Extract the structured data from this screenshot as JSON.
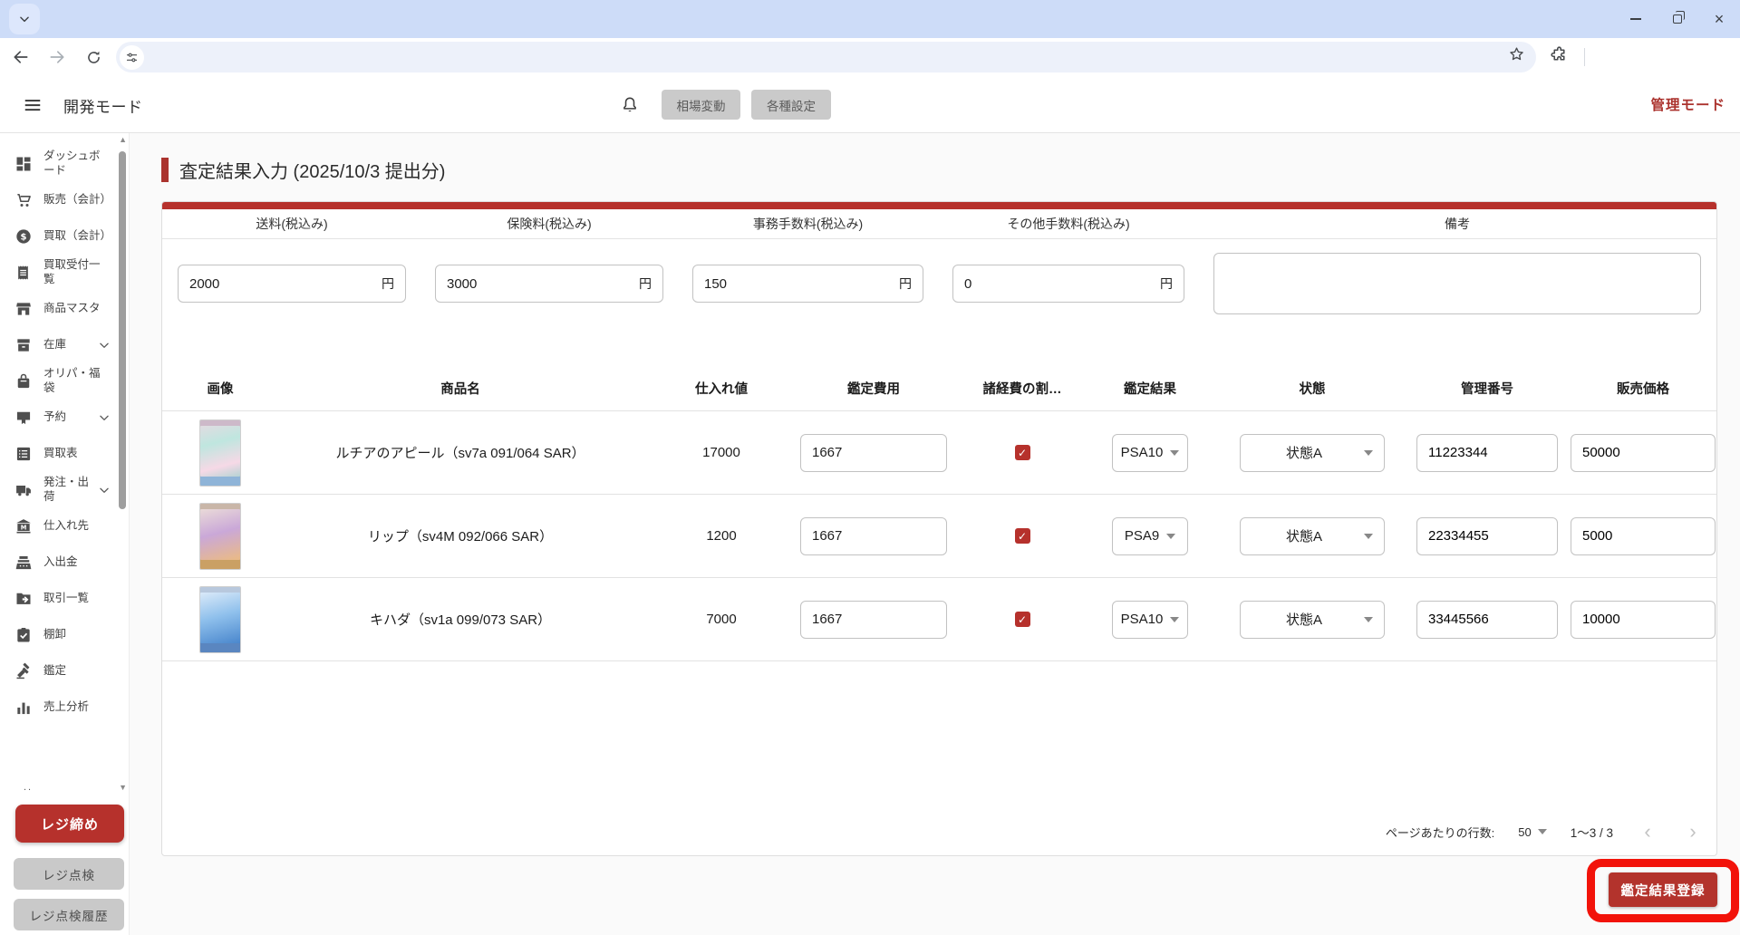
{
  "colors": {
    "accent": "#ab332e",
    "annotation": "#f2130a",
    "tabstrip": "#cddcf8",
    "header_button_bg": "#cacaca"
  },
  "icons": {
    "check": "✓",
    "page_prev": "‹",
    "page_next": "›",
    "scroll_up": "▲",
    "scroll_down": "▼",
    "close_window": "×",
    "more": ".."
  },
  "header": {
    "app_title": "開発モード",
    "market_button": "相場変動",
    "settings_button": "各種設定",
    "admin_link": "管理モード"
  },
  "sidebar": {
    "items": [
      {
        "label": "ダッシュボード",
        "icon": "dashboard-icon"
      },
      {
        "label": "販売（会計）",
        "icon": "cart-icon"
      },
      {
        "label": "買取（会計）",
        "icon": "money-icon"
      },
      {
        "label": "買取受付一覧",
        "icon": "receipt-icon"
      },
      {
        "label": "商品マスタ",
        "icon": "storefront-icon"
      },
      {
        "label": "在庫",
        "icon": "inventory-icon",
        "expandable": true
      },
      {
        "label": "オリパ・福袋",
        "icon": "bag-icon"
      },
      {
        "label": "予約",
        "icon": "reservation-icon",
        "expandable": true
      },
      {
        "label": "買取表",
        "icon": "list-icon"
      },
      {
        "label": "発注・出荷",
        "icon": "truck-icon",
        "expandable": true
      },
      {
        "label": "仕入れ先",
        "icon": "bank-icon"
      },
      {
        "label": "入出金",
        "icon": "register-icon"
      },
      {
        "label": "取引一覧",
        "icon": "folder-icon"
      },
      {
        "label": "棚卸",
        "icon": "clipboard-icon"
      },
      {
        "label": "鑑定",
        "icon": "gavel-icon"
      },
      {
        "label": "売上分析",
        "icon": "chart-icon"
      }
    ],
    "close_register_button": "レジ締め",
    "check_register_button": "レジ点検",
    "check_history_button": "レジ点検履歴"
  },
  "page": {
    "title": "査定結果入力 (2025/10/3 提出分)"
  },
  "fees": {
    "fields": [
      {
        "label": "送料(税込み)",
        "value": "2000",
        "unit": "円"
      },
      {
        "label": "保険料(税込み)",
        "value": "3000",
        "unit": "円"
      },
      {
        "label": "事務手数料(税込み)",
        "value": "150",
        "unit": "円"
      },
      {
        "label": "その他手数料(税込み)",
        "value": "0",
        "unit": "円"
      }
    ],
    "remarks_label": "備考",
    "remarks_value": ""
  },
  "table": {
    "columns": [
      "画像",
      "商品名",
      "仕入れ値",
      "鑑定費用",
      "諸経費の割…",
      "鑑定結果",
      "状態",
      "管理番号",
      "販売価格"
    ],
    "rows": [
      {
        "name": "ルチアのアピール（sv7a 091/064 SAR）",
        "purchase_price": "17000",
        "appraisal_fee": "1667",
        "expense_split_checked": true,
        "appraisal_result": "PSA10",
        "condition": "状態A",
        "management_number": "11223344",
        "selling_price": "50000"
      },
      {
        "name": "リップ（sv4M 092/066 SAR）",
        "purchase_price": "1200",
        "appraisal_fee": "1667",
        "expense_split_checked": true,
        "appraisal_result": "PSA9",
        "condition": "状態A",
        "management_number": "22334455",
        "selling_price": "5000"
      },
      {
        "name": "キハダ（sv1a 099/073 SAR）",
        "purchase_price": "7000",
        "appraisal_fee": "1667",
        "expense_split_checked": true,
        "appraisal_result": "PSA10",
        "condition": "状態A",
        "management_number": "33445566",
        "selling_price": "10000"
      }
    ],
    "pagination": {
      "rows_label": "ページあたりの行数:",
      "rows_value": "50",
      "range": "1〜3 / 3"
    }
  },
  "actions": {
    "register_button": "鑑定結果登録"
  }
}
